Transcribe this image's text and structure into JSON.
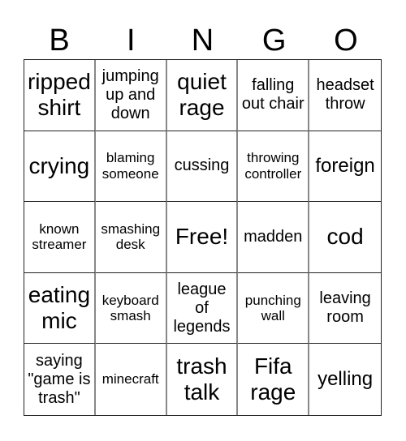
{
  "header": [
    "B",
    "I",
    "N",
    "G",
    "O"
  ],
  "cells": [
    {
      "text": "ripped shirt",
      "size": "xl"
    },
    {
      "text": "jumping up and down",
      "size": "m"
    },
    {
      "text": "quiet rage",
      "size": "xl"
    },
    {
      "text": "falling out chair",
      "size": "m"
    },
    {
      "text": "headset throw",
      "size": "m"
    },
    {
      "text": "crying",
      "size": "xl"
    },
    {
      "text": "blaming someone",
      "size": "s"
    },
    {
      "text": "cussing",
      "size": "m"
    },
    {
      "text": "throwing controller",
      "size": "s"
    },
    {
      "text": "foreign",
      "size": "l"
    },
    {
      "text": "known streamer",
      "size": "s"
    },
    {
      "text": "smashing desk",
      "size": "s"
    },
    {
      "text": "Free!",
      "size": "xl"
    },
    {
      "text": "madden",
      "size": "m"
    },
    {
      "text": "cod",
      "size": "xl"
    },
    {
      "text": "eating mic",
      "size": "xl"
    },
    {
      "text": "keyboard smash",
      "size": "s"
    },
    {
      "text": "league of legends",
      "size": "m"
    },
    {
      "text": "punching wall",
      "size": "s"
    },
    {
      "text": "leaving room",
      "size": "m"
    },
    {
      "text": "saying \"game is trash\"",
      "size": "m"
    },
    {
      "text": "minecraft",
      "size": "s"
    },
    {
      "text": "trash talk",
      "size": "xl"
    },
    {
      "text": "Fifa rage",
      "size": "xl"
    },
    {
      "text": "yelling",
      "size": "l"
    }
  ]
}
